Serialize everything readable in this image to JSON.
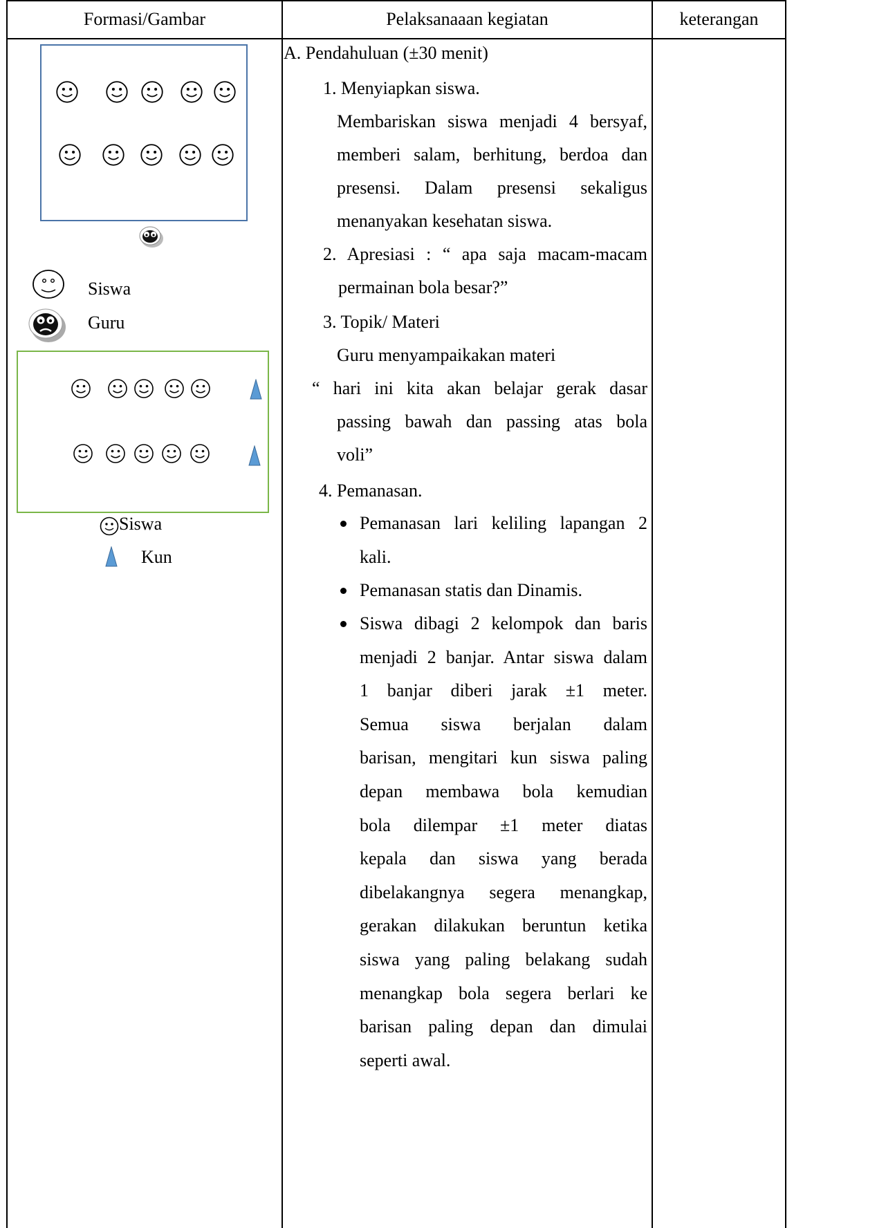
{
  "table": {
    "headers": [
      "Formasi/Gambar",
      "Pelaksanaaan kegiatan",
      "keterangan"
    ]
  },
  "diagram": {
    "legend1": {
      "student": "Siswa",
      "teacher": "Guru"
    },
    "legend2": {
      "student": "Siswa",
      "cone": "Kun"
    },
    "colors": {
      "box1": "#4a74a8",
      "box2": "#7ab648",
      "cone": "#5b9bd5"
    }
  },
  "activity": {
    "section": "A. Pendahuluan (±30 menit)",
    "step1_title": "1. Menyiapkan siswa.",
    "step1_lines": [
      "Membariskan siswa menjadi 4 bersyaf,",
      "memberi salam, berhitung, berdoa dan",
      "presensi. Dalam presensi sekaligus",
      "menanyakan kesehatan siswa."
    ],
    "step2_lines": [
      "2. Apresiasi : “ apa saja macam-macam",
      "permainan bola besar?”"
    ],
    "step3_title": "3. Topik/ Materi",
    "step3_lines": [
      "Guru menyampaikakan materi",
      "“ hari ini kita akan belajar gerak dasar",
      "passing bawah dan passing atas bola",
      "voli”"
    ],
    "step4_title": "4.  Pemanasan.",
    "bullet1_lines": [
      "Pemanasan lari keliling lapangan 2",
      "kali."
    ],
    "bullet2_lines": [
      "Pemanasan statis dan Dinamis."
    ],
    "bullet3_lines": [
      "Siswa dibagi 2 kelompok dan baris",
      "menjadi 2 banjar. Antar siswa dalam",
      "1 banjar diberi jarak ±1 meter.",
      "Semua siswa  berjalan dalam",
      "barisan, mengitari kun siswa paling",
      "depan membawa bola kemudian",
      "bola dilempar   ±1 meter diatas",
      "kepala dan siswa yang berada",
      "dibelakangnya segera menangkap,",
      "gerakan dilakukan beruntun ketika",
      "siswa yang paling belakang sudah",
      "menangkap bola segera berlari ke",
      "barisan paling depan dan dimulai",
      "seperti awal."
    ]
  }
}
